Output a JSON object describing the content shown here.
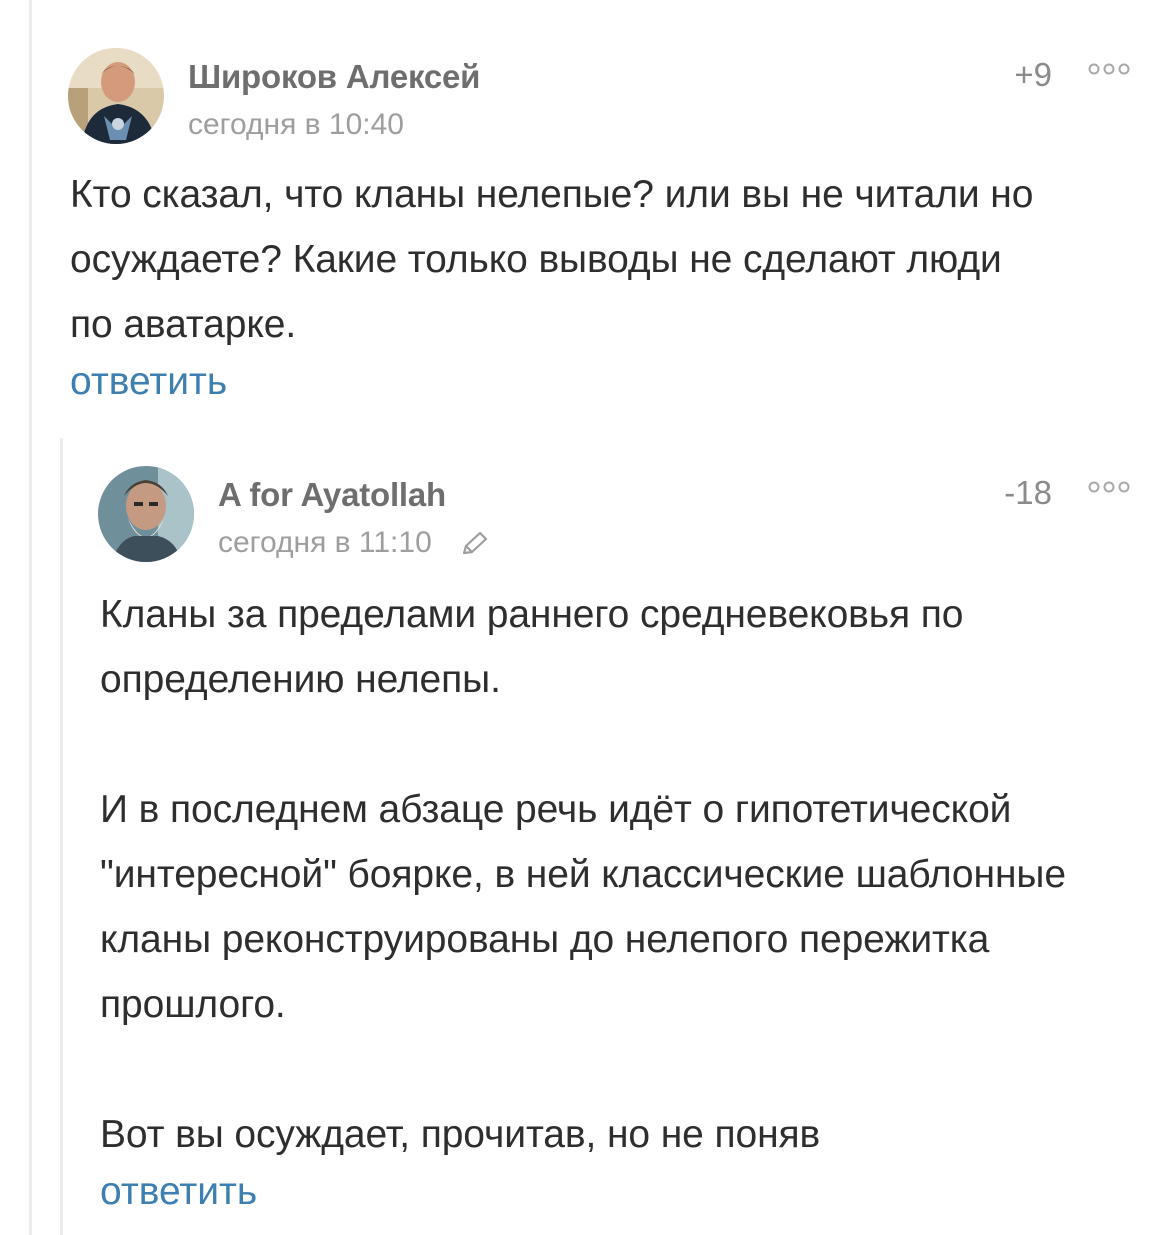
{
  "comments": [
    {
      "author": "Широков Алексей",
      "time": "сегодня в 10:40",
      "rating": "+9",
      "avatar_icon": "user-avatar-icon",
      "text_lines": [
        "Кто сказал, что кланы нелепые? или вы не читали но",
        "осуждаете? Какие только выводы не сделают люди",
        "по аватарке."
      ],
      "reply_label": "ответить"
    },
    {
      "author": "A for Ayatollah",
      "time": "сегодня в 11:10",
      "edited_icon": "pencil-icon",
      "rating": "-18",
      "avatar_icon": "user-avatar-icon",
      "paragraphs": [
        "Кланы за пределами раннего средневековья по определению нелепы.",
        "И в последнем абзаце речь идёт о гипотетической \"интересной\" боярке, в ней классические шаблонные кланы реконструированы до нелепого пережитка прошлого.",
        "Вот вы осуждает, прочитав, но не поняв"
      ],
      "reply_label": "ответить"
    }
  ],
  "more_icon": "more-options-icon",
  "colors": {
    "link": "#3d7fb0",
    "author": "#6e6e6e",
    "meta": "#9e9e9e",
    "text": "#2e2e2e",
    "thread_line": "#ececec"
  }
}
